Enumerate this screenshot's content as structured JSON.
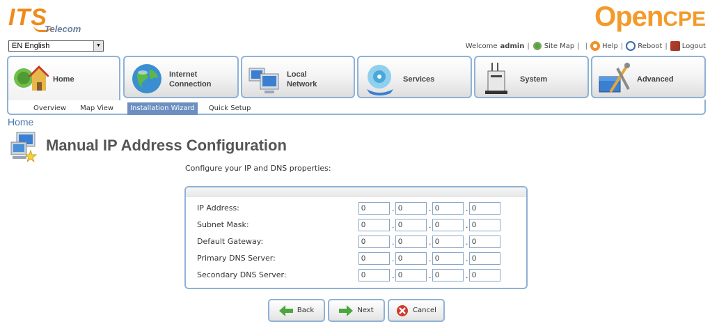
{
  "brand": {
    "its": "ITS",
    "telecom": "Telecom",
    "open": "Open",
    "cpe": "CPE"
  },
  "language": {
    "selected": "EN English"
  },
  "topbar": {
    "welcome": "Welcome",
    "user": "admin",
    "site_map": "Site Map",
    "help": "Help",
    "reboot": "Reboot",
    "logout": "Logout"
  },
  "nav": {
    "tabs": [
      {
        "label": "Home",
        "icon": "home-icon"
      },
      {
        "label": "Internet Connection",
        "line1": "Internet",
        "line2": "Connection",
        "icon": "globe-icon"
      },
      {
        "label": "Local Network",
        "line1": "Local",
        "line2": "Network",
        "icon": "computers-icon"
      },
      {
        "label": "Services",
        "icon": "services-icon"
      },
      {
        "label": "System",
        "icon": "router-icon"
      },
      {
        "label": "Advanced",
        "icon": "toolbox-icon"
      }
    ],
    "active_tab": "Home",
    "subtabs": [
      "Overview",
      "Map View",
      "Installation Wizard",
      "Quick Setup"
    ],
    "active_subtab": "Installation Wizard"
  },
  "breadcrumb": "Home",
  "page": {
    "title": "Manual IP Address Configuration",
    "intro": "Configure your IP and DNS properties:"
  },
  "form": {
    "rows": [
      {
        "label": "IP Address:",
        "octets": [
          "0",
          "0",
          "0",
          "0"
        ]
      },
      {
        "label": "Subnet Mask:",
        "octets": [
          "0",
          "0",
          "0",
          "0"
        ]
      },
      {
        "label": "Default Gateway:",
        "octets": [
          "0",
          "0",
          "0",
          "0"
        ]
      },
      {
        "label": "Primary DNS Server:",
        "octets": [
          "0",
          "0",
          "0",
          "0"
        ]
      },
      {
        "label": "Secondary DNS Server:",
        "octets": [
          "0",
          "0",
          "0",
          "0"
        ]
      }
    ],
    "separator": "."
  },
  "buttons": {
    "back": "Back",
    "next": "Next",
    "cancel": "Cancel"
  },
  "colors": {
    "accent_orange": "#f39a2a",
    "frame_blue": "#8fb2d6",
    "active_subtab": "#6b8fc0",
    "link_blue": "#4a7ab0"
  }
}
